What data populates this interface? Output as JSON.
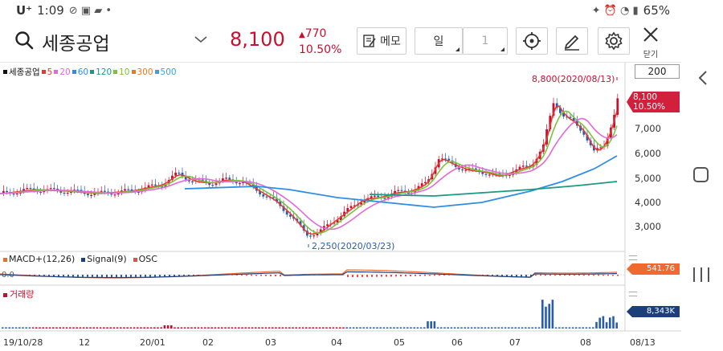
{
  "status_bar": {
    "carrier": "U⁺",
    "time": "1:09",
    "battery": "65%"
  },
  "header": {
    "stock_name": "세종공업",
    "price": "8,100",
    "change_arrow": "▲",
    "change_amount": "770",
    "change_percent": "10.50%",
    "memo_label": "메모",
    "period_label": "일",
    "period_value": "1",
    "close_label": "닫기"
  },
  "chart": {
    "legend": [
      {
        "label": "세종공업",
        "color": "#111111"
      },
      {
        "label": "5",
        "color": "#e53935"
      },
      {
        "label": "20",
        "color": "#e06ad8"
      },
      {
        "label": "60",
        "color": "#2e8ee6"
      },
      {
        "label": "120",
        "color": "#1a9a84"
      },
      {
        "label": "10",
        "color": "#7cc23a"
      },
      {
        "label": "300",
        "color": "#e87a2a"
      },
      {
        "label": "500",
        "color": "#3aa0e0"
      }
    ],
    "scale_box": "200",
    "price_tag": {
      "price": "8,100",
      "percent": "10.50%"
    },
    "y_labels": [
      "7,000",
      "6,000",
      "5,000",
      "4,000",
      "3,000"
    ],
    "high_annotation": "8,800(2020/08/13)",
    "low_annotation": "2,250(2020/03/23)",
    "macd_legend": [
      {
        "label": "MACD+(12,26)",
        "color": "#f06a30"
      },
      {
        "label": "Signal(9)",
        "color": "#1a3f7a"
      },
      {
        "label": "OSC",
        "color": "#e05050"
      }
    ],
    "macd_zero": "0.0",
    "macd_value": "541.76",
    "volume_legend": "거래량",
    "volume_value": "8,343K",
    "x_labels": [
      "19/10/28",
      "12",
      "20/01",
      "02",
      "03",
      "04",
      "05",
      "06",
      "07",
      "08",
      "08/13"
    ]
  },
  "colors": {
    "up": "#c8102e",
    "down": "#2a5ea8",
    "accent": "#d21f3c"
  },
  "icons": [
    "search-icon",
    "chevron-down-icon",
    "memo-icon",
    "crosshair-icon",
    "draw-icon",
    "gear-icon",
    "close-icon"
  ]
}
